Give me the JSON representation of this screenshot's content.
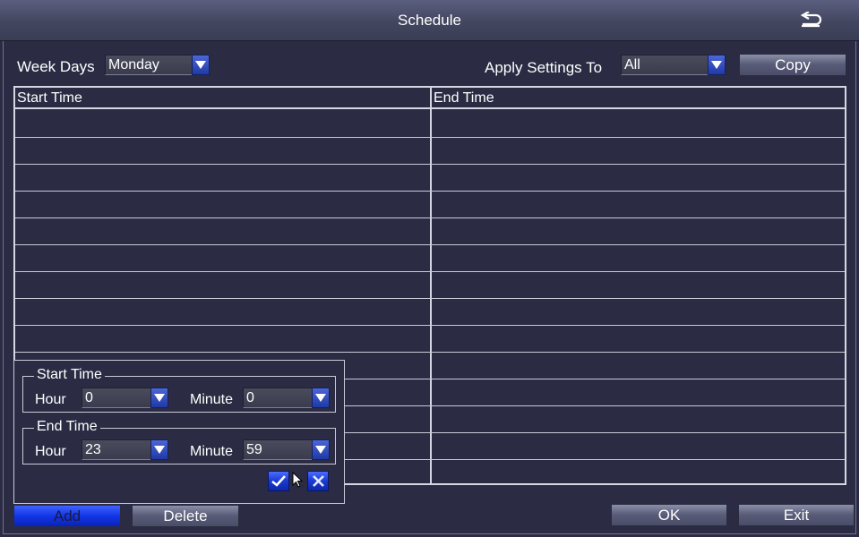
{
  "window": {
    "title": "Schedule",
    "back_icon": "return-arrow-icon"
  },
  "filters": {
    "week_days_label": "Week Days",
    "week_days_value": "Monday",
    "apply_label": "Apply Settings To",
    "apply_value": "All",
    "copy_label": "Copy"
  },
  "table": {
    "columns": [
      "Start Time",
      "End Time"
    ],
    "rows": []
  },
  "popup": {
    "start_group": {
      "legend": "Start Time",
      "hour_label": "Hour",
      "hour_value": "0",
      "minute_label": "Minute",
      "minute_value": "0"
    },
    "end_group": {
      "legend": "End Time",
      "hour_label": "Hour",
      "hour_value": "23",
      "minute_label": "Minute",
      "minute_value": "59"
    },
    "confirm_icon": "checkmark-icon",
    "cancel_icon": "close-icon"
  },
  "footer": {
    "add_label": "Add",
    "delete_label": "Delete",
    "ok_label": "OK",
    "exit_label": "Exit"
  },
  "colors": {
    "background": "#2b2c44",
    "accent_blue": "#1a3ad4",
    "border": "#d6d7e2"
  }
}
